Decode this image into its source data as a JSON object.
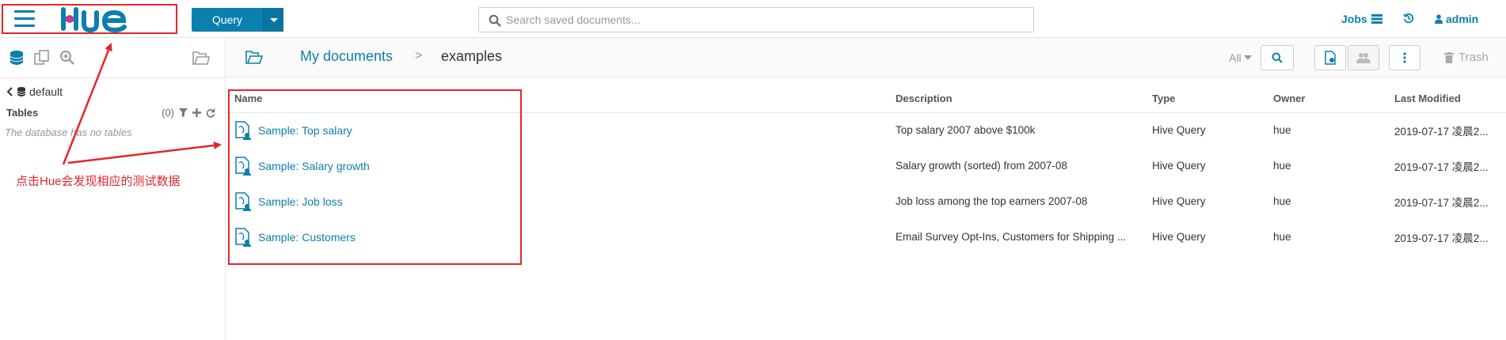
{
  "topbar": {
    "app_logo": "Hue",
    "query_button": "Query",
    "search_placeholder": "Search saved documents...",
    "jobs_label": "Jobs",
    "user_label": "admin"
  },
  "sidebar": {
    "back_label": "default",
    "tables_label": "Tables",
    "tables_count": "(0)",
    "empty_message": "The database has no tables"
  },
  "annotation": {
    "note": "点击Hue会发现相应的测试数据",
    "color": "#e3262b"
  },
  "breadcrumb": {
    "root": "My documents",
    "separator": ">",
    "current": "examples"
  },
  "header_tools": {
    "filter_label": "All",
    "trash_label": "Trash"
  },
  "table": {
    "columns": [
      "Name",
      "Description",
      "Type",
      "Owner",
      "Last Modified"
    ],
    "rows": [
      {
        "name": "Sample: Top salary",
        "description": "Top salary 2007 above $100k",
        "type": "Hive Query",
        "owner": "hue",
        "modified": "2019-07-17 凌晨2..."
      },
      {
        "name": "Sample: Salary growth",
        "description": "Salary growth (sorted) from 2007-08",
        "type": "Hive Query",
        "owner": "hue",
        "modified": "2019-07-17 凌晨2..."
      },
      {
        "name": "Sample: Job loss",
        "description": "Job loss among the top earners 2007-08",
        "type": "Hive Query",
        "owner": "hue",
        "modified": "2019-07-17 凌晨2..."
      },
      {
        "name": "Sample: Customers",
        "description": "Email Survey Opt-Ins, Customers for Shipping ...",
        "type": "Hive Query",
        "owner": "hue",
        "modified": "2019-07-17 凌晨2..."
      }
    ]
  },
  "colors": {
    "accent": "#0b7fad",
    "annotation": "#e3262b"
  }
}
